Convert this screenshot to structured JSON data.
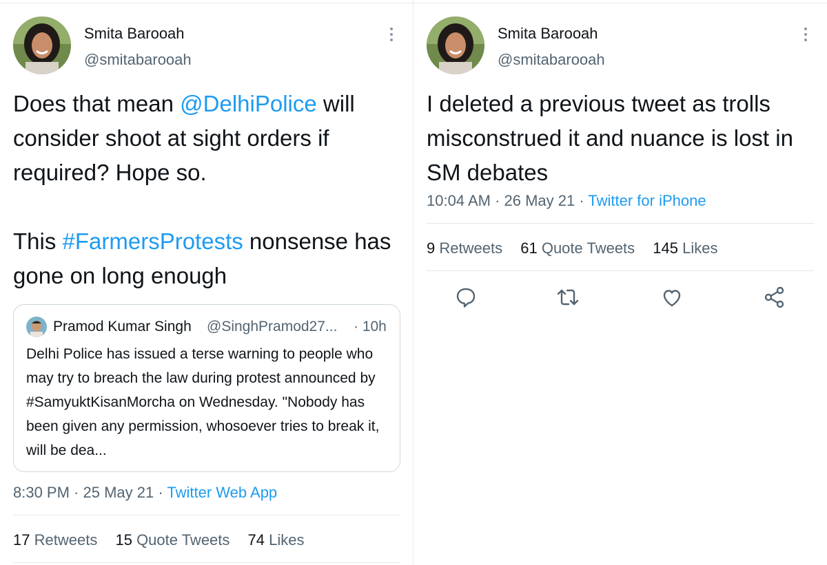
{
  "left": {
    "author": {
      "name": "Smita Barooah",
      "handle": "@smitabarooah"
    },
    "text": {
      "p1_a": "Does that mean ",
      "p1_mention": "@DelhiPolice",
      "p1_b": " will consider shoot at sight orders if required? Hope so.",
      "p2_a": "This ",
      "p2_hashtag": "#FarmersProtests",
      "p2_b": " nonsense has gone on long enough"
    },
    "quote": {
      "name": "Pramod Kumar Singh",
      "handle": "@SinghPramod27...",
      "time": "· 10h",
      "text": "Delhi Police has issued a terse warning to people who may try to breach the law during protest announced by #SamyuktKisanMorcha on Wednesday. \"Nobody has been given any permission, whosoever tries to break it, will be dea..."
    },
    "meta": {
      "time": "8:30 PM",
      "date": "25 May 21",
      "source": "Twitter Web App"
    },
    "stats": {
      "retweets_count": "17",
      "retweets_label": "Retweets",
      "quotes_count": "15",
      "quotes_label": "Quote Tweets",
      "likes_count": "74",
      "likes_label": "Likes"
    }
  },
  "right": {
    "author": {
      "name": "Smita Barooah",
      "handle": "@smitabarooah"
    },
    "text": "I deleted a previous tweet as trolls misconstrued it and nuance is lost in SM debates",
    "meta": {
      "time": "10:04 AM",
      "date": "26 May 21",
      "source": "Twitter for iPhone"
    },
    "stats": {
      "retweets_count": "9",
      "retweets_label": "Retweets",
      "quotes_count": "61",
      "quotes_label": "Quote Tweets",
      "likes_count": "145",
      "likes_label": "Likes"
    },
    "actions": [
      "reply-icon",
      "retweet-icon",
      "like-icon",
      "share-icon"
    ]
  },
  "colors": {
    "link": "#1d9bf0",
    "text": "#0f1419",
    "secondary": "#536471",
    "border": "#e1e8ed"
  }
}
